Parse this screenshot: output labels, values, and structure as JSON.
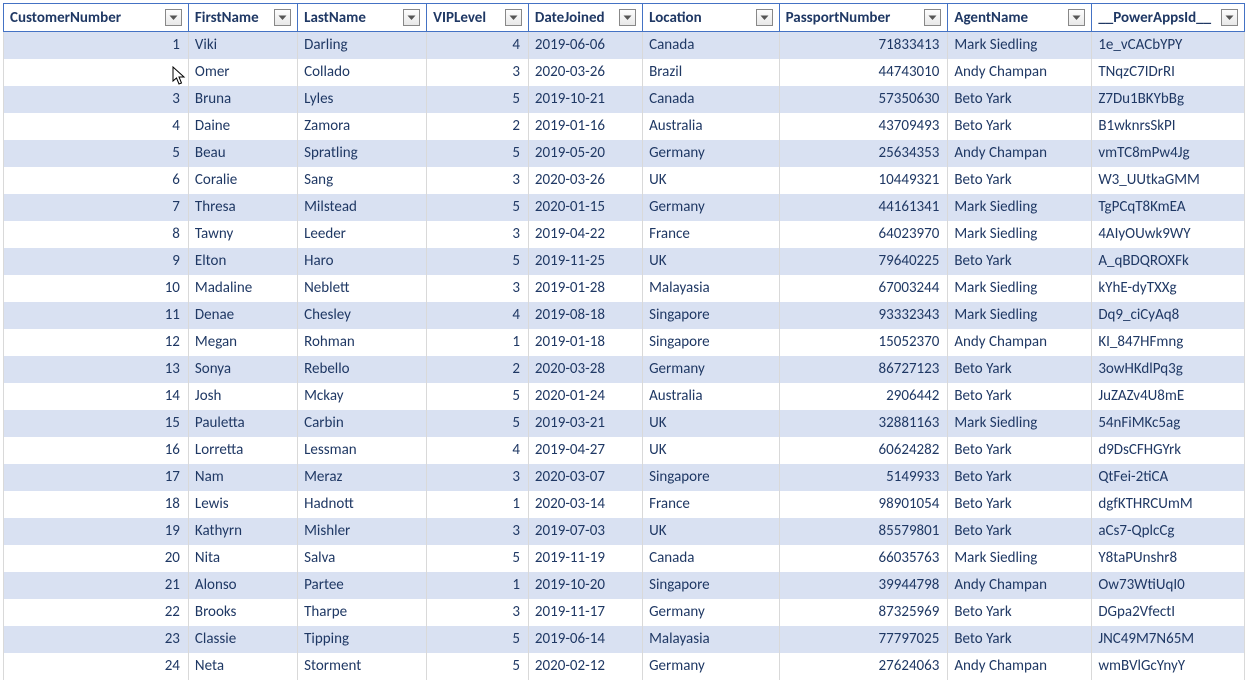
{
  "columns": [
    "CustomerNumber",
    "FirstName",
    "LastName",
    "VIPLevel",
    "DateJoined",
    "Location",
    "PassportNumber",
    "AgentName",
    "__PowerAppsId__"
  ],
  "rows": [
    {
      "num": 1,
      "first": "Viki",
      "last": "Darling",
      "vip": 4,
      "date": "2019-06-06",
      "loc": "Canada",
      "pass": 71833413,
      "agent": "Mark Siedling",
      "pid": "1e_vCACbYPY"
    },
    {
      "num": "",
      "first": "Omer",
      "last": "Collado",
      "vip": 3,
      "date": "2020-03-26",
      "loc": "Brazil",
      "pass": 44743010,
      "agent": "Andy Champan",
      "pid": "TNqzC7IDrRI"
    },
    {
      "num": 3,
      "first": "Bruna",
      "last": "Lyles",
      "vip": 5,
      "date": "2019-10-21",
      "loc": "Canada",
      "pass": 57350630,
      "agent": "Beto Yark",
      "pid": "Z7Du1BKYbBg"
    },
    {
      "num": 4,
      "first": "Daine",
      "last": "Zamora",
      "vip": 2,
      "date": "2019-01-16",
      "loc": "Australia",
      "pass": 43709493,
      "agent": "Beto Yark",
      "pid": "B1wknrsSkPI"
    },
    {
      "num": 5,
      "first": "Beau",
      "last": "Spratling",
      "vip": 5,
      "date": "2019-05-20",
      "loc": "Germany",
      "pass": 25634353,
      "agent": "Andy Champan",
      "pid": "vmTC8mPw4Jg"
    },
    {
      "num": 6,
      "first": "Coralie",
      "last": "Sang",
      "vip": 3,
      "date": "2020-03-26",
      "loc": "UK",
      "pass": 10449321,
      "agent": "Beto Yark",
      "pid": "W3_UUtkaGMM"
    },
    {
      "num": 7,
      "first": "Thresa",
      "last": "Milstead",
      "vip": 5,
      "date": "2020-01-15",
      "loc": "Germany",
      "pass": 44161341,
      "agent": "Mark Siedling",
      "pid": "TgPCqT8KmEA"
    },
    {
      "num": 8,
      "first": "Tawny",
      "last": "Leeder",
      "vip": 3,
      "date": "2019-04-22",
      "loc": "France",
      "pass": 64023970,
      "agent": "Mark Siedling",
      "pid": "4AIyOUwk9WY"
    },
    {
      "num": 9,
      "first": "Elton",
      "last": "Haro",
      "vip": 5,
      "date": "2019-11-25",
      "loc": "UK",
      "pass": 79640225,
      "agent": "Beto Yark",
      "pid": "A_qBDQROXFk"
    },
    {
      "num": 10,
      "first": "Madaline",
      "last": "Neblett",
      "vip": 3,
      "date": "2019-01-28",
      "loc": "Malayasia",
      "pass": 67003244,
      "agent": "Mark Siedling",
      "pid": "kYhE-dyTXXg"
    },
    {
      "num": 11,
      "first": "Denae",
      "last": "Chesley",
      "vip": 4,
      "date": "2019-08-18",
      "loc": "Singapore",
      "pass": 93332343,
      "agent": "Mark Siedling",
      "pid": "Dq9_ciCyAq8"
    },
    {
      "num": 12,
      "first": "Megan",
      "last": "Rohman",
      "vip": 1,
      "date": "2019-01-18",
      "loc": "Singapore",
      "pass": 15052370,
      "agent": "Andy Champan",
      "pid": "KI_847HFmng"
    },
    {
      "num": 13,
      "first": "Sonya",
      "last": "Rebello",
      "vip": 2,
      "date": "2020-03-28",
      "loc": "Germany",
      "pass": 86727123,
      "agent": "Beto Yark",
      "pid": "3owHKdlPq3g"
    },
    {
      "num": 14,
      "first": "Josh",
      "last": "Mckay",
      "vip": 5,
      "date": "2020-01-24",
      "loc": "Australia",
      "pass": 2906442,
      "agent": "Beto Yark",
      "pid": "JuZAZv4U8mE"
    },
    {
      "num": 15,
      "first": "Pauletta",
      "last": "Carbin",
      "vip": 5,
      "date": "2019-03-21",
      "loc": "UK",
      "pass": 32881163,
      "agent": "Mark Siedling",
      "pid": "54nFiMKc5ag"
    },
    {
      "num": 16,
      "first": "Lorretta",
      "last": "Lessman",
      "vip": 4,
      "date": "2019-04-27",
      "loc": "UK",
      "pass": 60624282,
      "agent": "Beto Yark",
      "pid": "d9DsCFHGYrk"
    },
    {
      "num": 17,
      "first": "Nam",
      "last": "Meraz",
      "vip": 3,
      "date": "2020-03-07",
      "loc": "Singapore",
      "pass": 5149933,
      "agent": "Beto Yark",
      "pid": "QtFei-2tiCA"
    },
    {
      "num": 18,
      "first": "Lewis",
      "last": "Hadnott",
      "vip": 1,
      "date": "2020-03-14",
      "loc": "France",
      "pass": 98901054,
      "agent": "Beto Yark",
      "pid": "dgfKTHRCUmM"
    },
    {
      "num": 19,
      "first": "Kathyrn",
      "last": "Mishler",
      "vip": 3,
      "date": "2019-07-03",
      "loc": "UK",
      "pass": 85579801,
      "agent": "Beto Yark",
      "pid": "aCs7-QplcCg"
    },
    {
      "num": 20,
      "first": "Nita",
      "last": "Salva",
      "vip": 5,
      "date": "2019-11-19",
      "loc": "Canada",
      "pass": 66035763,
      "agent": "Mark Siedling",
      "pid": "Y8taPUnshr8"
    },
    {
      "num": 21,
      "first": "Alonso",
      "last": "Partee",
      "vip": 1,
      "date": "2019-10-20",
      "loc": "Singapore",
      "pass": 39944798,
      "agent": "Andy Champan",
      "pid": "Ow73WtiUqI0"
    },
    {
      "num": 22,
      "first": "Brooks",
      "last": "Tharpe",
      "vip": 3,
      "date": "2019-11-17",
      "loc": "Germany",
      "pass": 87325969,
      "agent": "Beto Yark",
      "pid": "DGpa2VfectI"
    },
    {
      "num": 23,
      "first": "Classie",
      "last": "Tipping",
      "vip": 5,
      "date": "2019-06-14",
      "loc": "Malayasia",
      "pass": 77797025,
      "agent": "Beto Yark",
      "pid": "JNC49M7N65M"
    },
    {
      "num": 24,
      "first": "Neta",
      "last": "Storment",
      "vip": 5,
      "date": "2020-02-12",
      "loc": "Germany",
      "pass": 27624063,
      "agent": "Andy Champan",
      "pid": "wmBVlGcYnyY"
    }
  ]
}
